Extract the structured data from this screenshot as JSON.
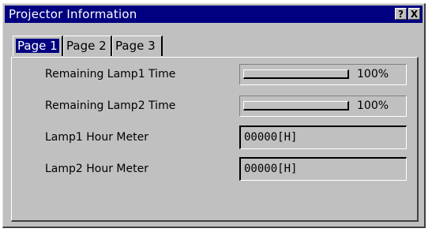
{
  "window": {
    "title": "Projector Information"
  },
  "titlebar_buttons": {
    "help": "?",
    "close": "X"
  },
  "tabs": [
    {
      "label": "Page 1",
      "active": true
    },
    {
      "label": "Page 2",
      "active": false
    },
    {
      "label": "Page 3",
      "active": false
    }
  ],
  "rows": {
    "lamp1_time": {
      "label": "Remaining Lamp1 Time",
      "percent_text": "100%",
      "fill_fraction": 1.0
    },
    "lamp2_time": {
      "label": "Remaining Lamp2 Time",
      "percent_text": "100%",
      "fill_fraction": 1.0
    },
    "lamp1_hours": {
      "label": "Lamp1 Hour Meter",
      "value": "00000[H]"
    },
    "lamp2_hours": {
      "label": "Lamp2 Hour Meter",
      "value": "00000[H]"
    }
  },
  "colors": {
    "titlebar": "#000080",
    "face": "#c0c0c0",
    "active_tab": "#000080"
  }
}
